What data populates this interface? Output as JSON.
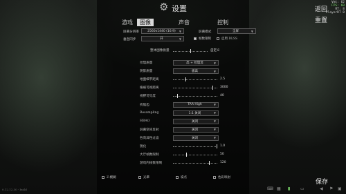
{
  "header": {
    "title": "设置"
  },
  "tabs": [
    {
      "label": "游戏"
    },
    {
      "label": "图像"
    },
    {
      "label": "声音"
    },
    {
      "label": "控制"
    }
  ],
  "fps_overlay": {
    "line1": "Vmt: 62",
    "line2": "FPS: 60",
    "line3": "RT: 8",
    "line4": "PlayerRT 8"
  },
  "side": {
    "back": "返回",
    "reset": "重置",
    "save": "保存"
  },
  "top_settings": {
    "resolution_label": "屏幕分辨率",
    "resolution_value": "2560x1440 (16:9)",
    "display_mode_label": "屏幕模式",
    "display_mode_value": "全屏",
    "vsync_label": "垂直同步",
    "vsync_value": "开",
    "frame_limit_label": "帧数限制",
    "frame_limit_checked": true,
    "dlss_label": "启用 DLSS",
    "dlss_checked": false,
    "ultra_label": "Ultra",
    "ultra_checked": false
  },
  "preset": {
    "label": "整体图像质量",
    "value": "自定义",
    "level": 0.5
  },
  "rows": [
    {
      "label": "纹理质量",
      "kind": "select",
      "value": "高 + 纹理流"
    },
    {
      "label": "阴影质量",
      "kind": "select",
      "value": "极高"
    },
    {
      "label": "地面细节距离",
      "kind": "slider",
      "value": "2.5",
      "level": 0.28
    },
    {
      "label": "植被可视距离",
      "kind": "slider",
      "value": "3000",
      "level": 0.9
    },
    {
      "label": "视野可见度",
      "kind": "slider",
      "value": "40",
      "level": 0.1
    },
    {
      "label": "抗锯齿",
      "kind": "select",
      "value": "TAA High"
    },
    {
      "label": "Resampling",
      "kind": "select",
      "value": "1:1 关闭"
    },
    {
      "label": "HBAO",
      "kind": "select",
      "value": "关闭"
    },
    {
      "label": "屏幕空间反射",
      "kind": "select",
      "value": "关闭"
    },
    {
      "label": "各向异性过滤",
      "kind": "select",
      "value": "关闭"
    },
    {
      "label": "锐化",
      "kind": "slider",
      "value": "1.0",
      "level": 1.0
    },
    {
      "label": "大厅帧数限制",
      "kind": "slider",
      "value": "50",
      "level": 0.3
    },
    {
      "label": "游戏内帧数限制",
      "kind": "slider",
      "value": "120",
      "level": 0.82
    }
  ],
  "checkboxes": [
    {
      "label": "Z-模糊",
      "checked": false
    },
    {
      "label": "光晕",
      "checked": false
    },
    {
      "label": "噪点",
      "checked": false
    },
    {
      "label": "色彩映射",
      "checked": false
    }
  ],
  "bottom_bar": {
    "version": "0.12.12.30 - build",
    "hint": "ESC"
  }
}
